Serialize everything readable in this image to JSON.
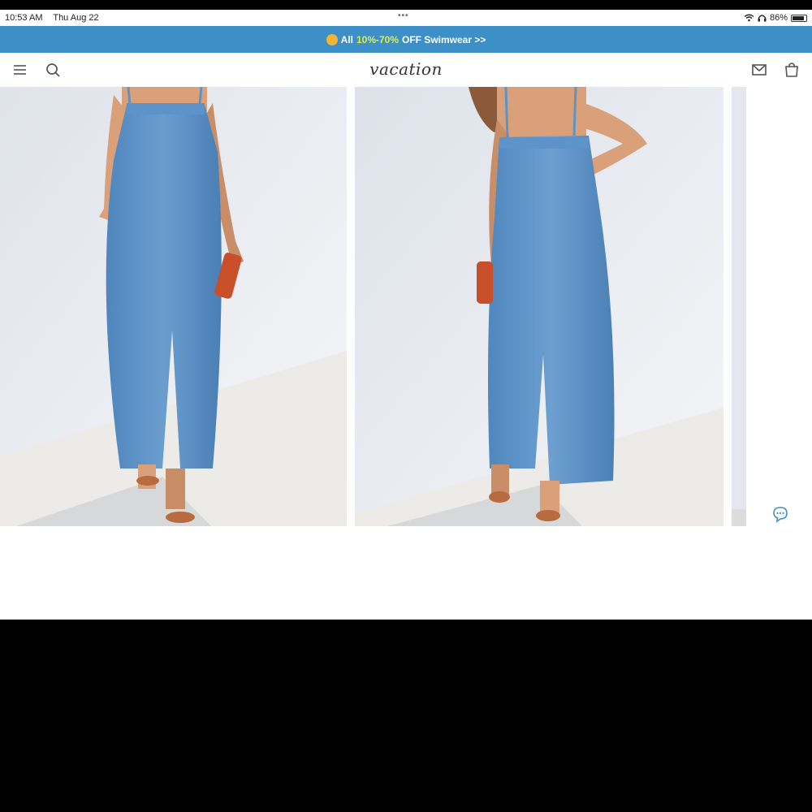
{
  "status_bar": {
    "time": "10:53 AM",
    "date": "Thu Aug 22",
    "battery": "86%",
    "battery_level": 0.86
  },
  "promo": {
    "prefix": "All",
    "highlight": "10%-70%",
    "suffix": "OFF Swimwear >>"
  },
  "header": {
    "logo": "vacation"
  },
  "icons": {
    "menu": "menu-icon",
    "search": "search-icon",
    "mail": "mail-icon",
    "bag": "shopping-bag-icon",
    "chat": "chat-icon",
    "wifi": "wifi-icon",
    "headphones": "headphones-icon",
    "battery": "battery-icon"
  },
  "colors": {
    "promo_bg": "#3d8fc7",
    "promo_highlight": "#e4f040",
    "denim": "#5b8fc4"
  }
}
